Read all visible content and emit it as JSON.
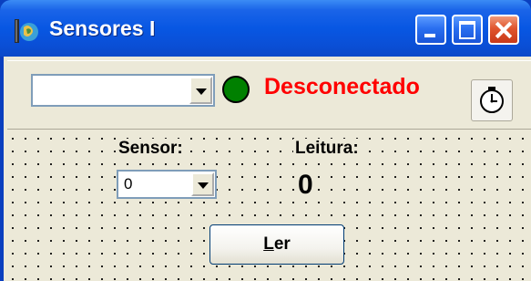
{
  "window": {
    "title": "Sensores I",
    "app_icon": "delphi-app-icon",
    "controls": {
      "minimize_icon": "minimize-icon",
      "maximize_icon": "maximize-icon",
      "close_icon": "close-icon"
    }
  },
  "toolbar": {
    "port_select": {
      "value": "",
      "arrow_icon": "chevron-down-icon"
    },
    "status": {
      "led_color": "#008000",
      "text": "Desconectado",
      "text_color": "#ff0000"
    },
    "clock_button_icon": "clock-icon"
  },
  "main": {
    "sensor_label": "Sensor:",
    "sensor_select": {
      "value": "0",
      "arrow_icon": "chevron-down-icon"
    },
    "reading_label": "Leitura:",
    "reading_value": "0",
    "read_button": {
      "mnemonic": "L",
      "rest": "er"
    }
  }
}
